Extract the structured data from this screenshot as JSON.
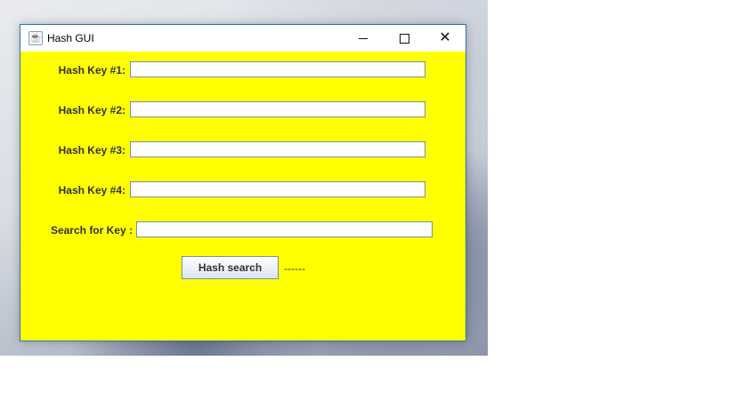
{
  "window": {
    "title": "Hash GUI",
    "icon": "java-icon",
    "background_color": "#ffff00",
    "title_bar_buttons": [
      "minimize-icon",
      "maximize-icon",
      "close-icon"
    ]
  },
  "form": {
    "fields": [
      {
        "label": "Hash Key #1:",
        "value": ""
      },
      {
        "label": "Hash Key #2:",
        "value": ""
      },
      {
        "label": "Hash Key #3:",
        "value": ""
      },
      {
        "label": "Hash Key #4:",
        "value": ""
      },
      {
        "label": "Search for Key :",
        "value": ""
      }
    ],
    "button_label": "Hash search",
    "result_text": "------"
  }
}
